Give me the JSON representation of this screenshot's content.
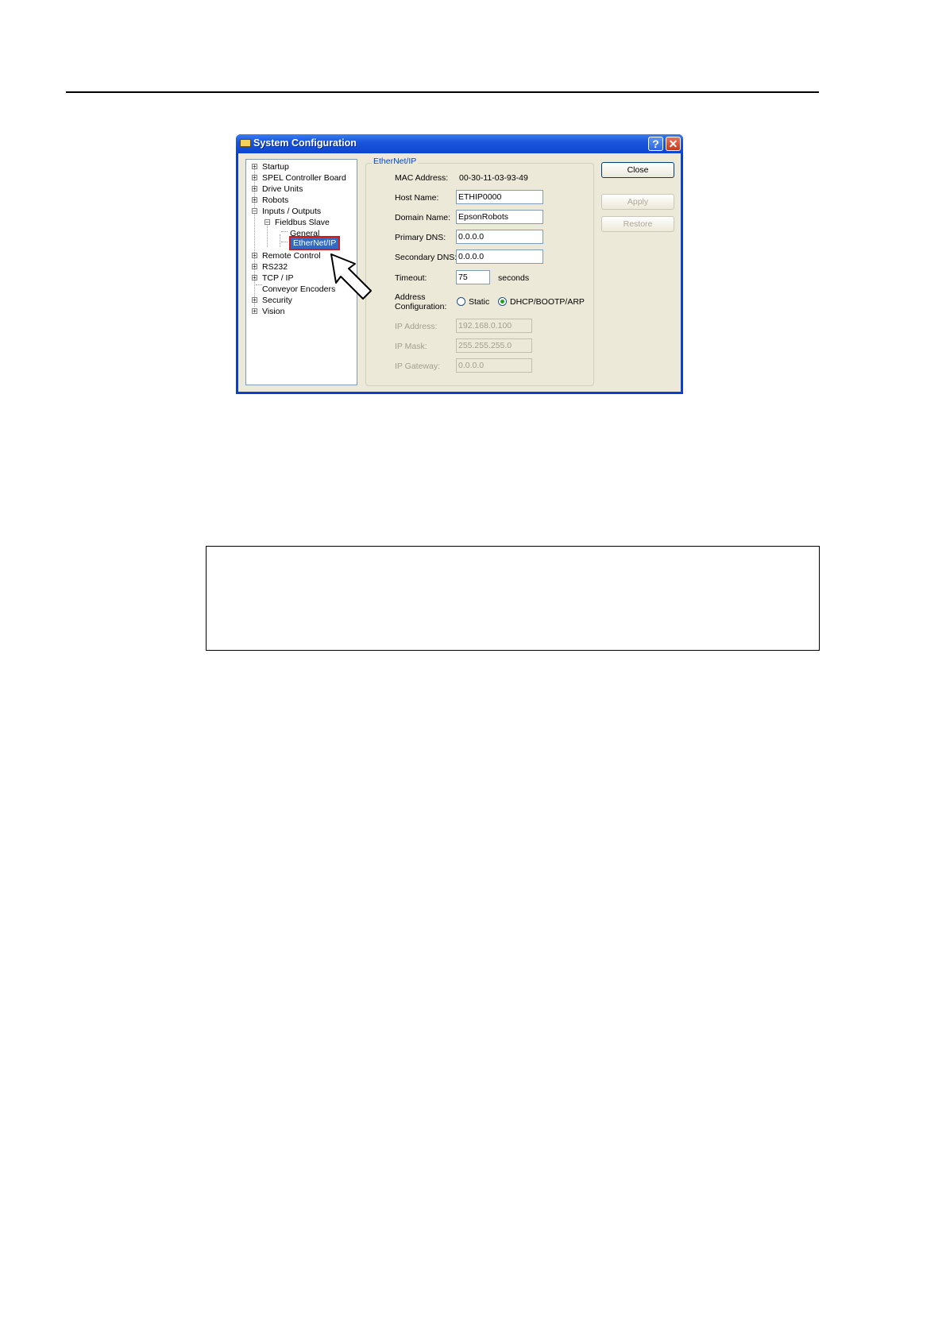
{
  "window": {
    "title": "System Configuration",
    "help_glyph": "?",
    "close_glyph": "✕"
  },
  "tree": {
    "items": [
      {
        "label": "Startup",
        "expander": "+"
      },
      {
        "label": "SPEL Controller Board",
        "expander": "+"
      },
      {
        "label": "Drive Units",
        "expander": "+"
      },
      {
        "label": "Robots",
        "expander": "+"
      },
      {
        "label": "Inputs / Outputs",
        "expander": "−"
      },
      {
        "label": "Fieldbus Slave",
        "expander": "−"
      },
      {
        "label": "General"
      },
      {
        "label": "EtherNet/IP"
      },
      {
        "label": "Remote Control",
        "expander": "+"
      },
      {
        "label": "RS232",
        "expander": "+"
      },
      {
        "label": "TCP / IP",
        "expander": "+"
      },
      {
        "label": "Conveyor Encoders"
      },
      {
        "label": "Security",
        "expander": "+"
      },
      {
        "label": "Vision",
        "expander": "+"
      }
    ]
  },
  "panel": {
    "group_title": "EtherNet/IP",
    "mac_label": "MAC Address:",
    "mac_value": "00-30-11-03-93-49",
    "host_label": "Host Name:",
    "host_value": "ETHIP0000",
    "domain_label": "Domain Name:",
    "domain_value": "EpsonRobots",
    "primary_dns_label": "Primary DNS:",
    "primary_dns_value": "0.0.0.0",
    "secondary_dns_label": "Secondary DNS:",
    "secondary_dns_value": "0.0.0.0",
    "timeout_label": "Timeout:",
    "timeout_value": "75",
    "timeout_unit": "seconds",
    "address_label_1": "Address",
    "address_label_2": "Configuration:",
    "radio_static": "Static",
    "radio_dhcp": "DHCP/BOOTP/ARP",
    "ip_address_label": "IP Address:",
    "ip_address_value": "192.168.0.100",
    "ip_mask_label": "IP Mask:",
    "ip_mask_value": "255.255.255.0",
    "ip_gateway_label": "IP Gateway:",
    "ip_gateway_value": "0.0.0.0"
  },
  "buttons": {
    "close": "Close",
    "apply": "Apply",
    "restore": "Restore"
  },
  "colors": {
    "title_blue": "#0a3fd1",
    "selection": "#316ac5",
    "highlight_red": "#d01a1a",
    "dialog_bg": "#ece9d8"
  }
}
